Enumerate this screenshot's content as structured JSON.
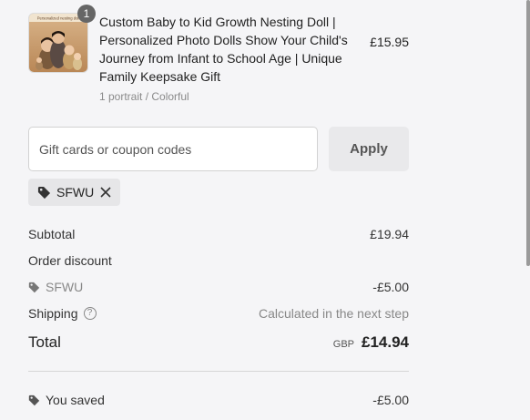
{
  "product": {
    "quantity": "1",
    "title": "Custom Baby to Kid Growth Nesting Doll | Personalized Photo Dolls Show Your Child's Journey from Infant to School Age | Unique Family Keepsake Gift",
    "variant": "1 portrait / Colorful",
    "price": "£15.95",
    "thumbnail_caption": "Personalized nesting doll"
  },
  "coupon": {
    "placeholder": "Gift cards or coupon codes",
    "value": "",
    "apply_label": "Apply",
    "applied_code": "SFWU"
  },
  "summary": {
    "subtotal_label": "Subtotal",
    "subtotal_value": "£19.94",
    "order_discount_label": "Order discount",
    "discount_code": "SFWU",
    "discount_value": "-£5.00",
    "shipping_label": "Shipping",
    "shipping_value": "Calculated in the next step",
    "total_label": "Total",
    "currency": "GBP",
    "total_value": "£14.94",
    "saved_label": "You saved",
    "saved_value": "-£5.00"
  },
  "icons": {
    "tag": "tag-icon",
    "remove": "close-icon",
    "help": "question-circle-icon"
  }
}
